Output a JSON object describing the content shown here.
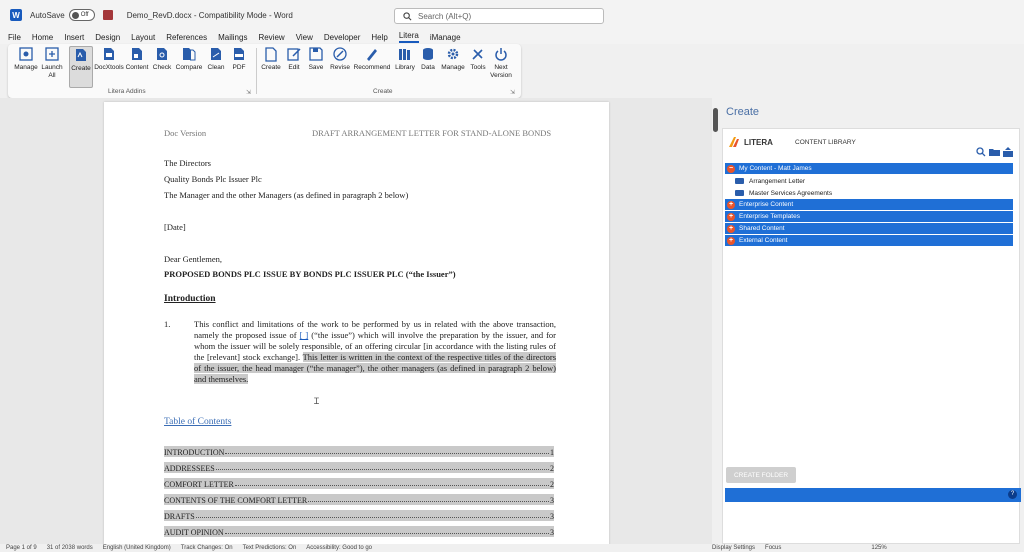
{
  "titlebar": {
    "autosave": "AutoSave",
    "toggle": "Off",
    "doc_title": "Demo_RevD.docx  -  Compatibility Mode  -  Word",
    "search_placeholder": "Search (Alt+Q)"
  },
  "menu": [
    "File",
    "Home",
    "Insert",
    "Design",
    "Layout",
    "References",
    "Mailings",
    "Review",
    "View",
    "Developer",
    "Help",
    "Litera",
    "iManage"
  ],
  "ribbon": {
    "litera_addins": [
      "Manage",
      "Launch All",
      "Create",
      "DocXtools",
      "Content",
      "Check",
      "Compare",
      "Clean",
      "PDF"
    ],
    "create": [
      "Create",
      "Edit",
      "Save",
      "Revise",
      "Recommend",
      "Library",
      "Data",
      "Manage",
      "Tools",
      "Next Version"
    ],
    "group1_label": "Litera Addins",
    "group2_label": "Create"
  },
  "document": {
    "header_left": "Doc Version",
    "header_right": "DRAFT ARRANGEMENT LETTER FOR STAND-ALONE BONDS",
    "addr1": "The Directors",
    "addr2": "Quality Bonds Plc Issuer Plc",
    "addr3": "The Manager and the other Managers (as defined in paragraph 2 below)",
    "date": "[Date]",
    "salutation": "Dear Gentlemen,",
    "subject": "PROPOSED BONDS PLC ISSUE BY BONDS PLC ISSUER PLC (“the Issuer”)",
    "heading": "Introduction",
    "para_num": "1.",
    "para_a": "This conflict and limitations of the work to be performed by us in related with the above transaction, namely the proposed issue of ",
    "para_bracket": "[ ]",
    "para_b": " (“the issue”) which will involve the preparation by the issuer, and for whom the issuer will be solely responsible, of an offering circular [in accordance with the listing rules of the [relevant] stock exchange].",
    "para_hl": "This letter is written in the context of the respective titles of the directors of the issuer, the head manager (“the manager”), the other managers (as defined in paragraph 2 below) and themselves.",
    "toc_title": "Table of Contents",
    "toc": [
      {
        "label": "INTRODUCTION",
        "page": "1"
      },
      {
        "label": "ADDRESSEES",
        "page": "2"
      },
      {
        "label": "COMFORT LETTER",
        "page": "2"
      },
      {
        "label": "CONTENTS OF THE COMFORT LETTER",
        "page": "3"
      },
      {
        "label": "DRAFTS",
        "page": "3"
      },
      {
        "label": "AUDIT OPINION",
        "page": "3"
      }
    ]
  },
  "pane": {
    "title": "Create",
    "brand": "LITERA",
    "tab": "CONTENT LIBRARY",
    "tree": [
      {
        "label": "My Content - Matt James",
        "type": "group"
      },
      {
        "label": "Arrangement Letter",
        "type": "item"
      },
      {
        "label": "Master Services Agreements",
        "type": "item"
      },
      {
        "label": "Enterprise Content",
        "type": "group"
      },
      {
        "label": "Enterprise Templates",
        "type": "group"
      },
      {
        "label": "Shared Content",
        "type": "group"
      },
      {
        "label": "External Content",
        "type": "group"
      }
    ],
    "create_folder": "CREATE FOLDER",
    "help": "?"
  },
  "status": {
    "page": "Page 1 of 9",
    "words": "31 of 2038 words",
    "lang": "English (United Kingdom)",
    "track": "Track Changes: On",
    "predictions": "Text Predictions: On",
    "access": "Accessibility: Good to go",
    "display": "Display Settings",
    "focus": "Focus",
    "zoom": "125%"
  },
  "colors": {
    "accent": "#185abd",
    "pane_blue": "#1f6fd6",
    "highlight": "#c9c9c9"
  }
}
